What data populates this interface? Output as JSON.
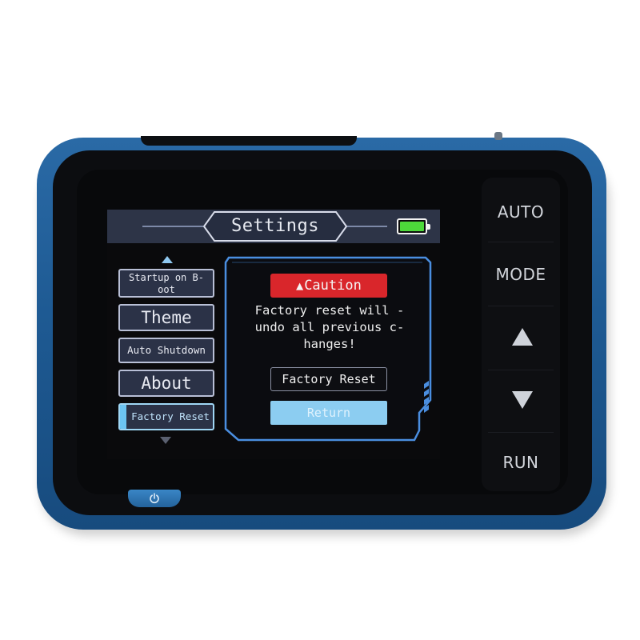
{
  "screen": {
    "title": "Settings",
    "battery_color": "#4dd93a",
    "menu": {
      "items": [
        {
          "label": "Startup on B-oot",
          "line1": "Startup on B-",
          "line2": "oot"
        },
        {
          "label": "Theme"
        },
        {
          "label": "Auto Shutdown"
        },
        {
          "label": "About"
        },
        {
          "label": "Factory Reset",
          "selected": true
        }
      ],
      "scroll_up_icon": "triangle-up-icon",
      "scroll_down_icon": "triangle-down-icon"
    },
    "dialog": {
      "caution_label": "Caution",
      "caution_icon": "warning-icon",
      "message_lines": [
        "Factory reset will -",
        "undo all previous c-",
        "hanges!"
      ],
      "confirm_label": "Factory Reset",
      "return_label": "Return"
    }
  },
  "hardware": {
    "auto_label": "AUTO",
    "mode_label": "MODE",
    "up_icon": "up-arrow-icon",
    "down_icon": "down-arrow-icon",
    "run_label": "RUN",
    "power_icon": "power-icon"
  },
  "colors": {
    "device_body": "#1e5a93",
    "caution_red": "#d9262b",
    "highlight_blue": "#8ccdf1",
    "dialog_border": "#4a8ee0"
  }
}
